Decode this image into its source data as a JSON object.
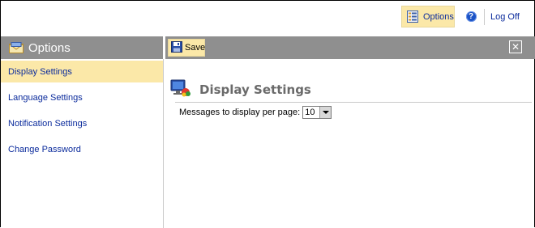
{
  "topbar": {
    "options_label": "Options",
    "help_glyph": "?",
    "logoff_label": "Log Off",
    "icons": {
      "options": "options-list-icon",
      "help": "help-icon"
    }
  },
  "sidebar": {
    "title": "Options",
    "icon": "envelope-icon",
    "items": [
      {
        "label": "Display Settings",
        "active": true
      },
      {
        "label": "Language Settings",
        "active": false
      },
      {
        "label": "Notification Settings",
        "active": false
      },
      {
        "label": "Change Password",
        "active": false
      }
    ]
  },
  "toolbar": {
    "save_label": "Save",
    "save_icon": "floppy-disk-icon",
    "close_glyph": "✕"
  },
  "main": {
    "title": "Display Settings",
    "title_icon": "monitor-icon",
    "settings": [
      {
        "label": "Messages to display per page:",
        "value": "10"
      }
    ]
  },
  "colors": {
    "highlight": "#fbe8a8",
    "header_gray": "#8f8f8f",
    "link_blue": "#0b2b9c",
    "title_gray": "#6a6a6a"
  }
}
